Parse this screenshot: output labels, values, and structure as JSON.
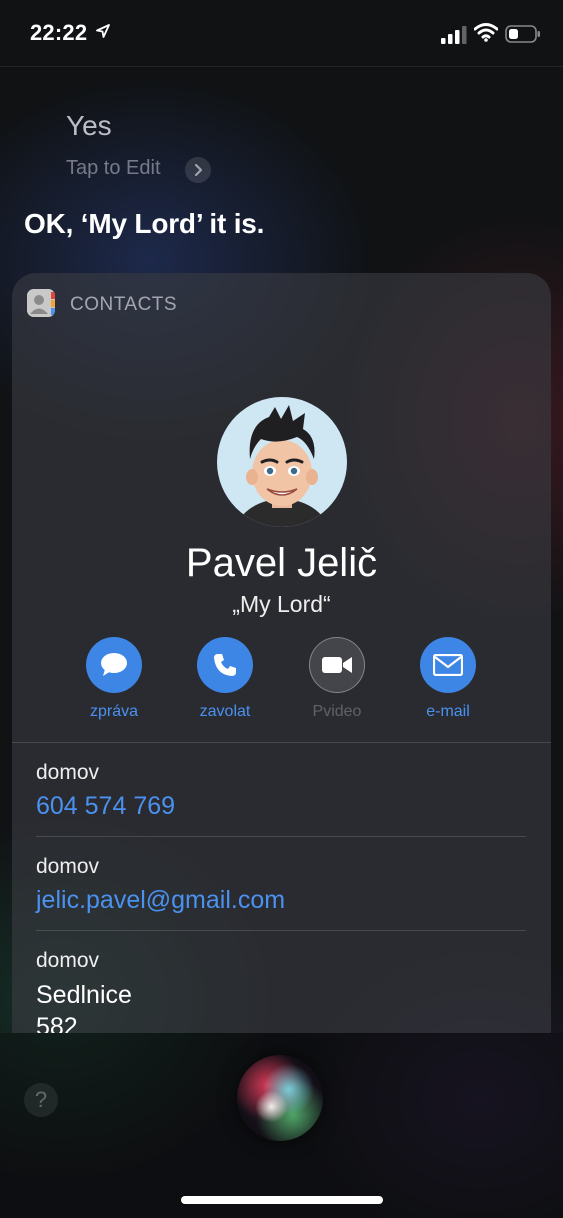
{
  "status_bar": {
    "time": "22:22",
    "icons": [
      "location-arrow-icon",
      "cellular-signal-icon",
      "wifi-icon",
      "battery-icon"
    ]
  },
  "siri": {
    "utterance": "Yes",
    "tap_to_edit": "Tap to Edit",
    "response": "OK, ‘My Lord’ it is."
  },
  "card": {
    "app_label": "CONTACTS",
    "contact": {
      "name": "Pavel Jelič",
      "nickname": "„My Lord“"
    },
    "actions": [
      {
        "label": "zpráva",
        "icon": "message-bubble-icon",
        "enabled": true
      },
      {
        "label": "zavolat",
        "icon": "phone-icon",
        "enabled": true
      },
      {
        "label": "Pvideo",
        "icon": "video-camera-icon",
        "enabled": false
      },
      {
        "label": "e-mail",
        "icon": "envelope-icon",
        "enabled": true
      }
    ],
    "fields": [
      {
        "label": "domov",
        "value": "604 574 769"
      },
      {
        "label": "domov",
        "value": "jelic.pavel@gmail.com"
      },
      {
        "label": "domov",
        "value_line1": "Sedlnice",
        "value_line2": "582"
      }
    ]
  },
  "bottom": {
    "help_glyph": "?"
  },
  "colors": {
    "accent": "#3d86e6",
    "link": "#4a91f0",
    "background": "#101214"
  }
}
